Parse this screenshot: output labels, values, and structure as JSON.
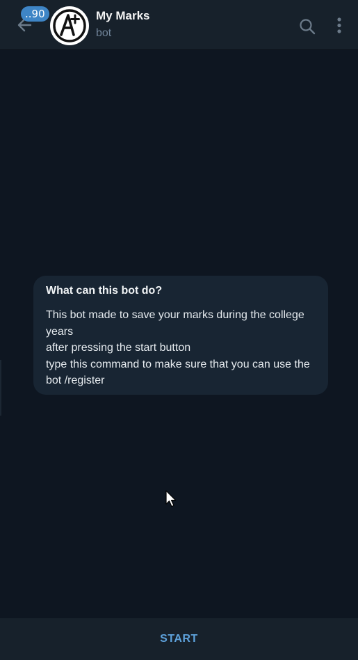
{
  "header": {
    "unread_badge": "..90",
    "chat_title": "My Marks",
    "chat_subtitle": "bot",
    "avatar_text": "A+"
  },
  "bot_info": {
    "title": "What can this bot do?",
    "description": "This bot made to save your marks during the college years\nafter pressing the start button\ntype this command to make sure that you can use the bot /register"
  },
  "footer": {
    "start_label": "START"
  },
  "icons": {
    "back": "arrow-left-icon",
    "search": "search-icon",
    "menu": "more-vertical-icon",
    "cursor": "mouse-pointer-icon"
  },
  "colors": {
    "background": "#0e1621",
    "header_background": "#17212b",
    "card_background": "#182533",
    "accent": "#5ea2dc",
    "badge": "#3e85c6",
    "subtitle": "#708499"
  }
}
